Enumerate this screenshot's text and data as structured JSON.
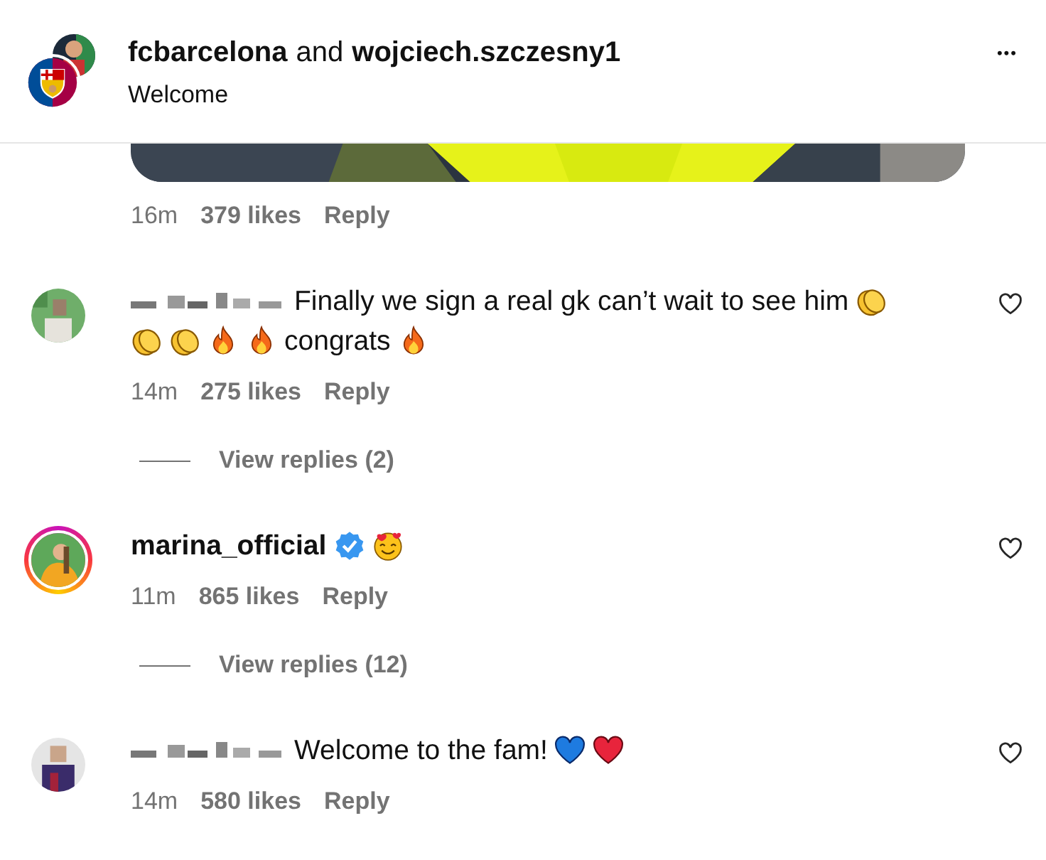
{
  "header": {
    "accounts": [
      {
        "name": "fcbarcelona"
      },
      {
        "name": "wojciech.szczesny1"
      }
    ],
    "joiner": "and",
    "caption": "Welcome",
    "more": "•••"
  },
  "post": {
    "kind": "picture",
    "meta": {
      "time": "16m",
      "likes": "379 likes",
      "reply": "Reply"
    }
  },
  "comments": [
    {
      "author_hidden": true,
      "verified": false,
      "story_ring": false,
      "parts": [
        {
          "kind": "text",
          "text": "Finally we sign a real gk can’t wait to see him"
        },
        {
          "kind": "clap"
        },
        {
          "kind": "break"
        },
        {
          "kind": "clap"
        },
        {
          "kind": "clap"
        },
        {
          "kind": "fire"
        },
        {
          "kind": "fire"
        },
        {
          "kind": "text",
          "text": "congrats"
        },
        {
          "kind": "fire"
        }
      ],
      "time": "14m",
      "likes": "275 likes",
      "reply": "Reply",
      "view_replies": "View replies (2)"
    },
    {
      "author_hidden": false,
      "author": "marina_official",
      "verified": true,
      "story_ring": true,
      "parts": [
        {
          "kind": "hearts-face"
        }
      ],
      "time": "11m",
      "likes": "865 likes",
      "reply": "Reply",
      "view_replies": "View replies (12)"
    },
    {
      "author_hidden": true,
      "verified": false,
      "story_ring": false,
      "parts": [
        {
          "kind": "text",
          "text": "Welcome to the fam!"
        },
        {
          "kind": "blue-heart"
        },
        {
          "kind": "red-heart"
        }
      ],
      "time": "14m",
      "likes": "580 likes",
      "reply": "Reply"
    }
  ]
}
